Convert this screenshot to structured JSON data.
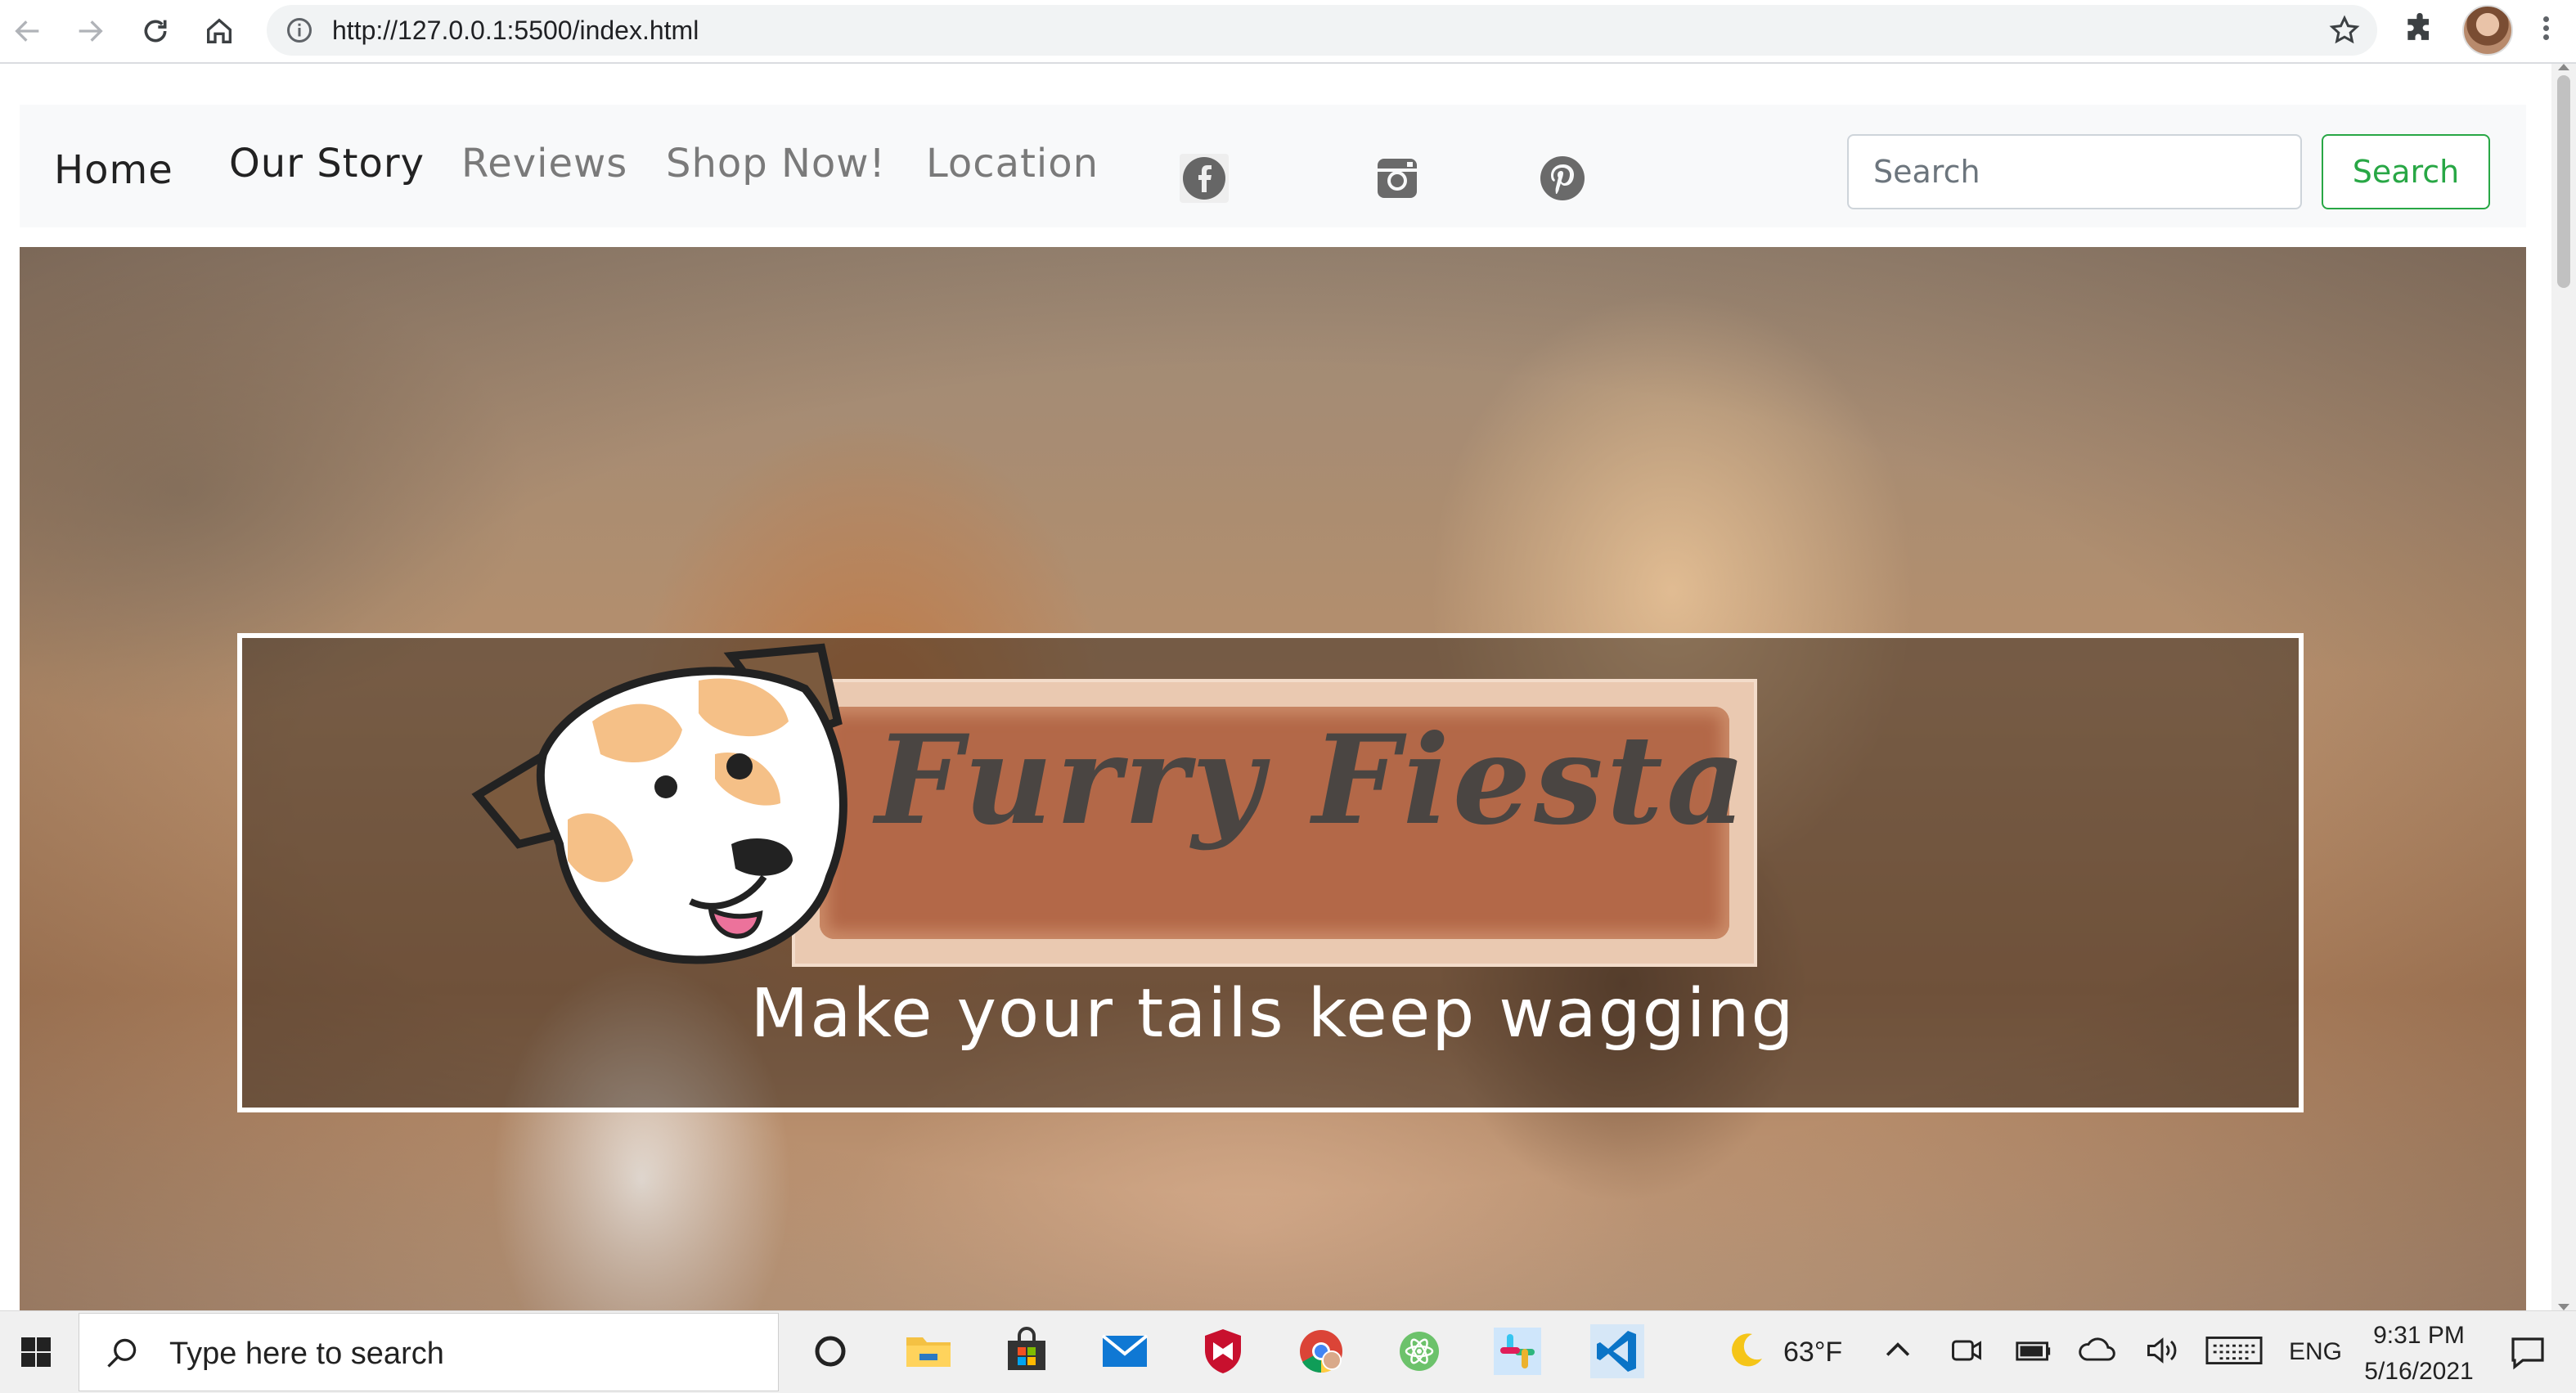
{
  "browser": {
    "url": "http://127.0.0.1:5500/index.html"
  },
  "site": {
    "nav": {
      "home": "Home",
      "our_story": "Our Story",
      "reviews": "Reviews",
      "shop": "Shop Now!",
      "location": "Location"
    },
    "social": [
      "facebook-icon",
      "instagram-icon",
      "pinterest-icon"
    ],
    "search": {
      "placeholder": "Search",
      "button": "Search"
    },
    "hero": {
      "logo_text": "Furry Fiesta",
      "tagline": "Make your tails keep wagging"
    },
    "colors": {
      "search_button": "#28a745",
      "logo_plate": "#b0694a"
    }
  },
  "taskbar": {
    "search_placeholder": "Type here to search",
    "weather_temp": "63°F",
    "language": "ENG",
    "time": "9:31 PM",
    "date": "5/16/2021",
    "apps": [
      "task-view-icon",
      "file-explorer-icon",
      "store-icon",
      "mail-icon",
      "mcafee-icon",
      "chrome-icon",
      "atom-icon",
      "slack-icon",
      "vscode-icon"
    ]
  }
}
